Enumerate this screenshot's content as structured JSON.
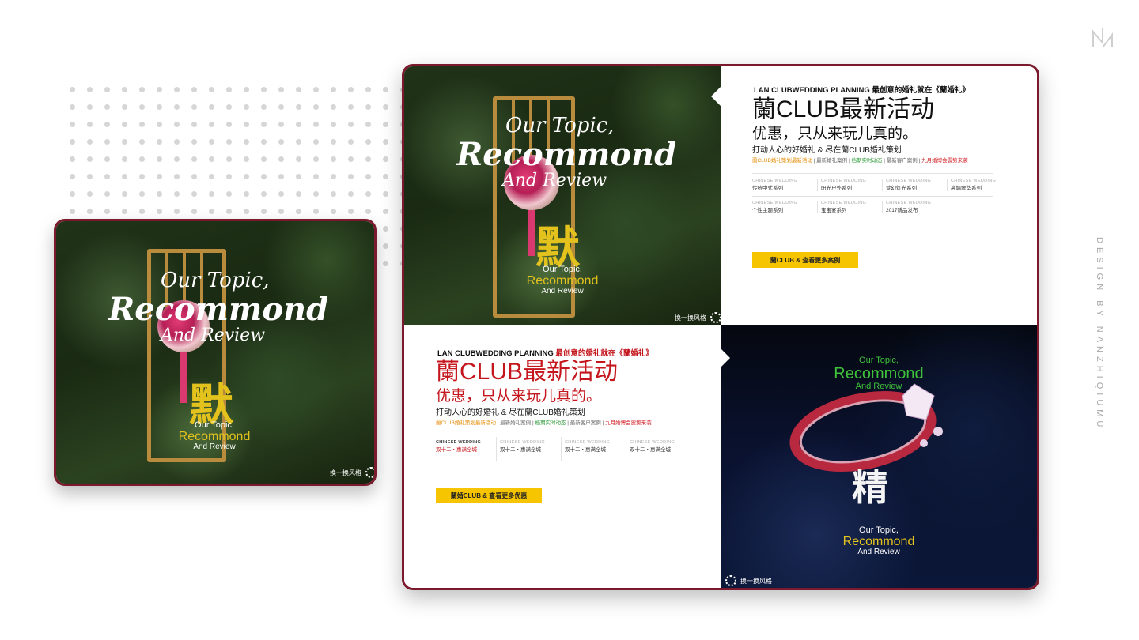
{
  "signature": "DESIGN BY NANZHIQIUMU",
  "colors": {
    "accent_red": "#c4161c",
    "frame": "#7a1a2c",
    "button": "#f7c400",
    "green_title": "#3fc23a",
    "yellow_text": "#e3c21d"
  },
  "icons": {
    "logo": "nz-logo-icon",
    "switch": "refresh-ring-icon"
  },
  "photo_card": {
    "script_line1": "Our Topic,",
    "script_line2": "Recommond",
    "script_line3": "And Review",
    "big_char": "默",
    "topic_line1": "Our Topic,",
    "topic_line2": "Recommond",
    "topic_line3": "And Review",
    "switch_label": "换一换风格"
  },
  "ring_card": {
    "topic_top_line1": "Our Topic,",
    "topic_top_line2": "Recommond",
    "topic_top_line3": "And Review",
    "big_char": "精",
    "topic_bottom_line1": "Our Topic,",
    "topic_bottom_line2": "Recommond",
    "topic_bottom_line3": "And Review",
    "switch_label": "换一换风格"
  },
  "promo_top": {
    "head_en": "LAN CLUBWEDDING PLANNING",
    "head_cn": "最创意的婚礼就在《蘭婚礼》",
    "title": "蘭CLUB最新活动",
    "subtitle": "优惠，只从来玩儿真的。",
    "tagline": "打动人心的好婚礼 & 尽在蘭CLUB婚礼策划",
    "links": [
      "蘭CLUB婚礼策划最新活动",
      "最新婚礼案例",
      "档期实时动态",
      "最新客户案例",
      "九月婚博会震势来袭"
    ],
    "grid": [
      {
        "en": "CHINESE WEDDING",
        "cn": "传统中式系列"
      },
      {
        "en": "CHINESE WEDDING",
        "cn": "阳光户外系列"
      },
      {
        "en": "CHINESE WEDDING",
        "cn": "梦幻灯光系列"
      },
      {
        "en": "CHINESE WEDDING",
        "cn": "高端奢华系列"
      },
      {
        "en": "CHINESE WEDDING",
        "cn": "个性主题系列"
      },
      {
        "en": "CHINESE WEDDING",
        "cn": "宝宝宴系列"
      },
      {
        "en": "CHINESE WEDDING",
        "cn": "2017新品发布"
      }
    ],
    "button": "蘭CLUB & 查看更多案例"
  },
  "promo_bottom": {
    "head_en": "LAN CLUBWEDDING PLANNING",
    "head_cn": "最创意的婚礼就在《蘭婚礼》",
    "title": "蘭CLUB最新活动",
    "subtitle": "优惠，只从来玩儿真的。",
    "tagline": "打动人心的好婚礼 & 尽在蘭CLUB婚礼策划",
    "links": [
      "蘭CLUB婚礼策划最新活动",
      "最新婚礼案例",
      "档期实时动态",
      "最新客户案例",
      "九月婚博会震势来袭"
    ],
    "grid": [
      {
        "en": "CHINESE WEDDING",
        "cn": "双十二・惠满全城"
      },
      {
        "en": "CHINESE WEDDING",
        "cn": "双十二・惠满全城"
      },
      {
        "en": "CHINESE WEDDING",
        "cn": "双十二・惠满全城"
      },
      {
        "en": "CHINESE WEDDING",
        "cn": "双十二・惠满全城"
      }
    ],
    "button": "蘭婚CLUB & 查看更多优惠"
  }
}
